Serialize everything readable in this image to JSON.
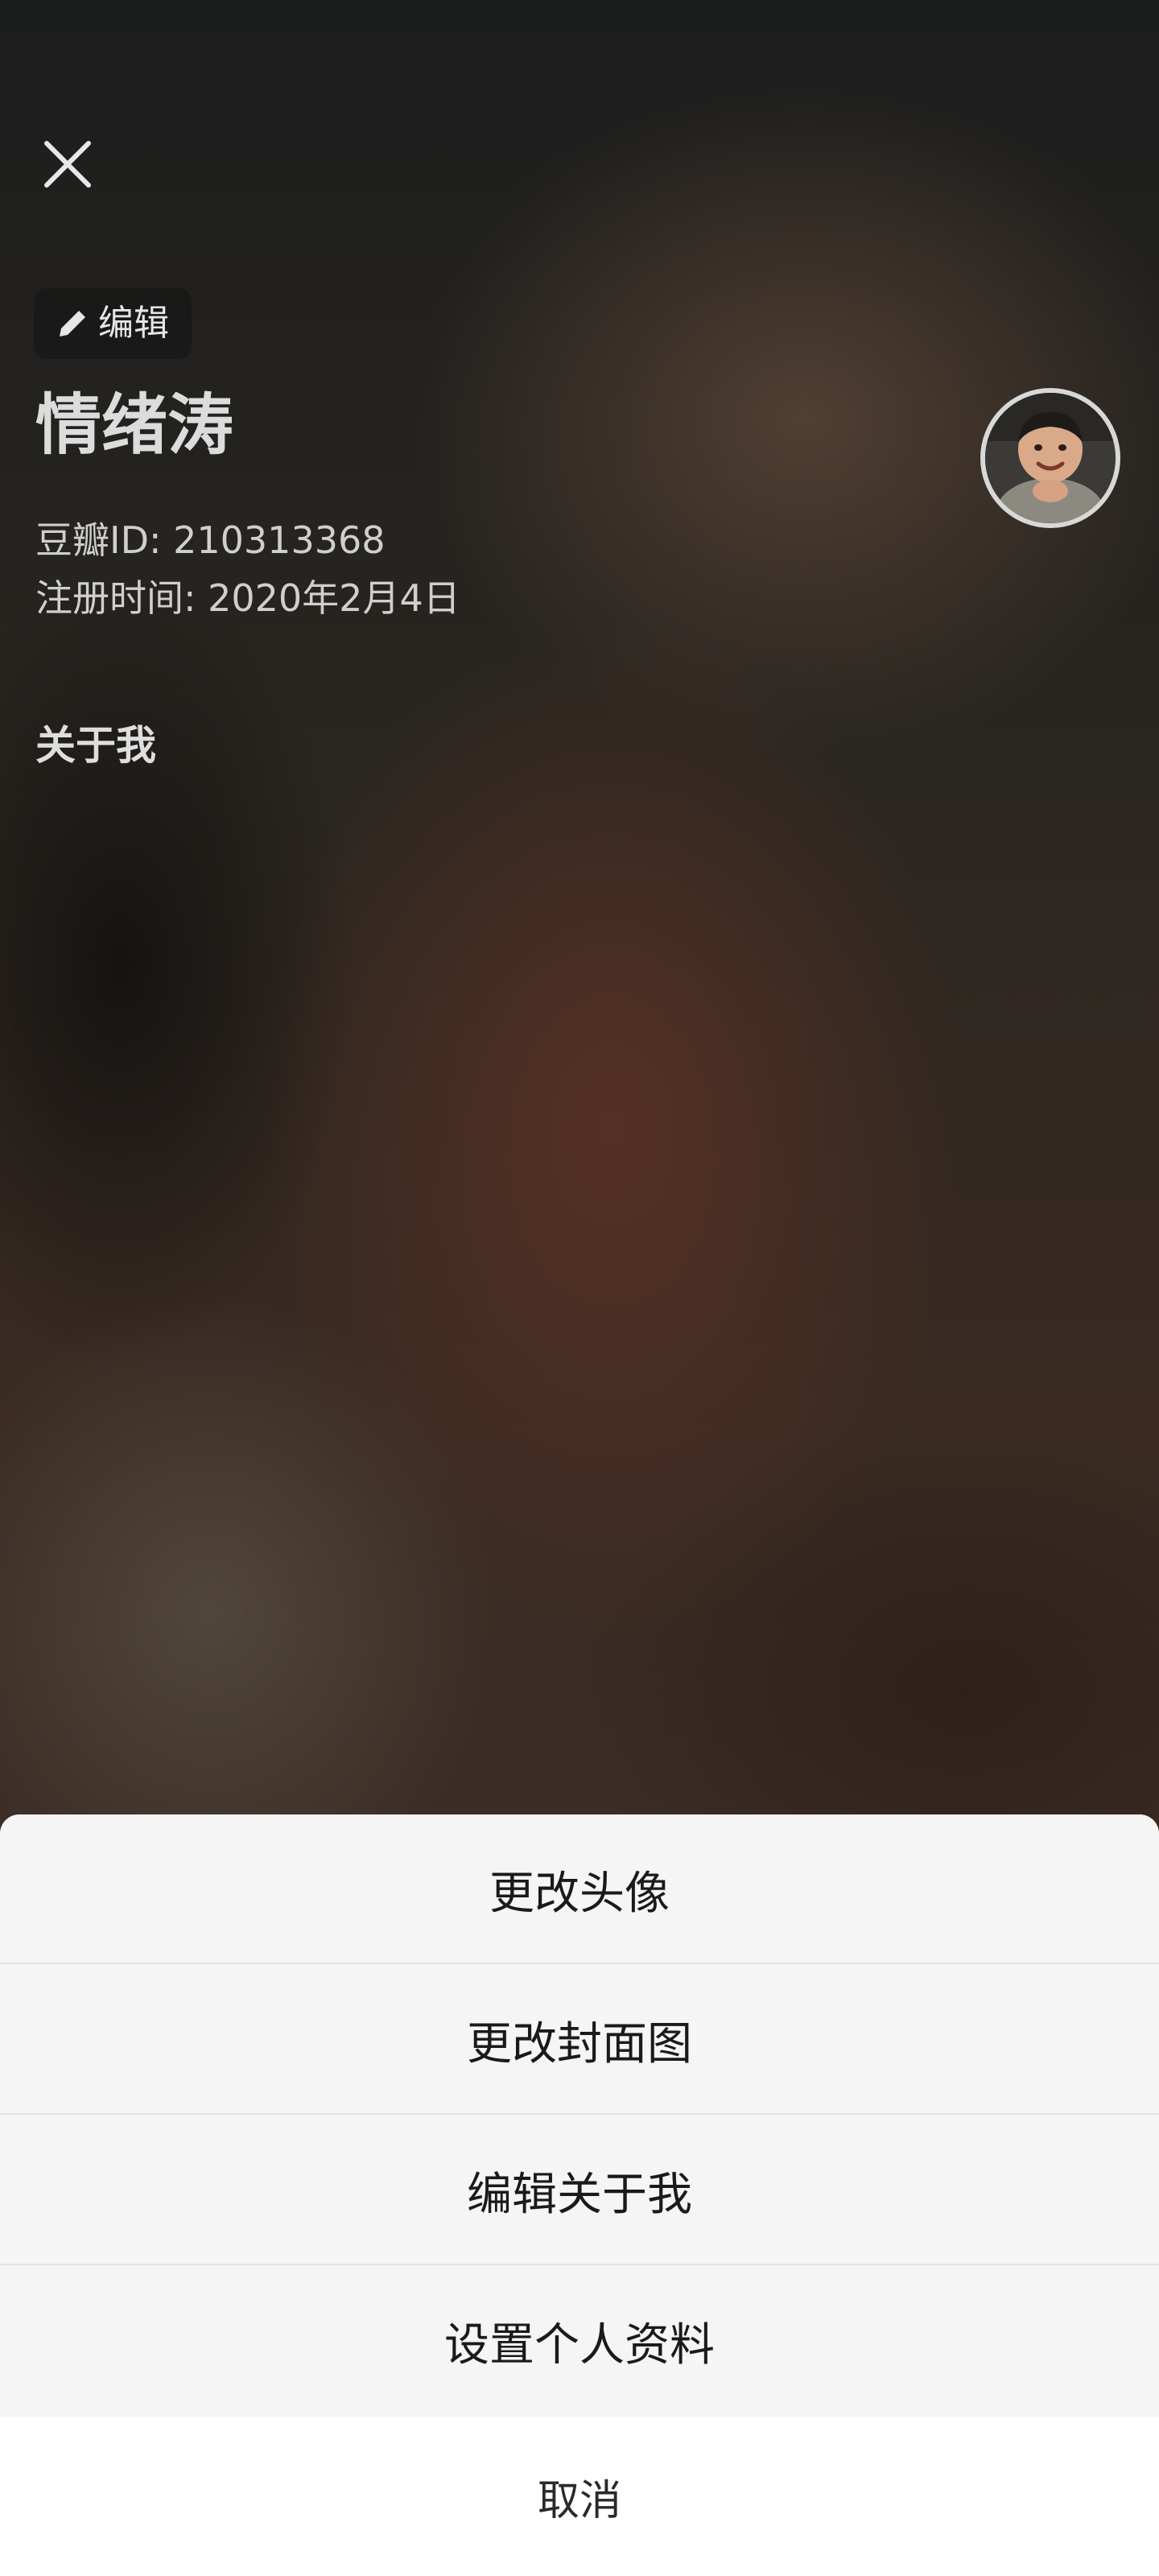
{
  "header": {
    "close_icon": "close-icon"
  },
  "profile": {
    "edit_label": "编辑",
    "edit_icon": "pencil-icon",
    "name": "情绪涛",
    "douban_id": "豆瓣ID: 210313368",
    "register_time": "注册时间: 2020年2月4日",
    "about_heading": "关于我"
  },
  "action_sheet": {
    "items": [
      {
        "label": "更改头像"
      },
      {
        "label": "更改封面图"
      },
      {
        "label": "编辑关于我"
      },
      {
        "label": "设置个人资料"
      }
    ],
    "cancel_label": "取消"
  },
  "colors": {
    "sheet_background": "#f5f5f5",
    "cancel_background": "#ffffff",
    "text_dark": "#1a1a1a"
  }
}
